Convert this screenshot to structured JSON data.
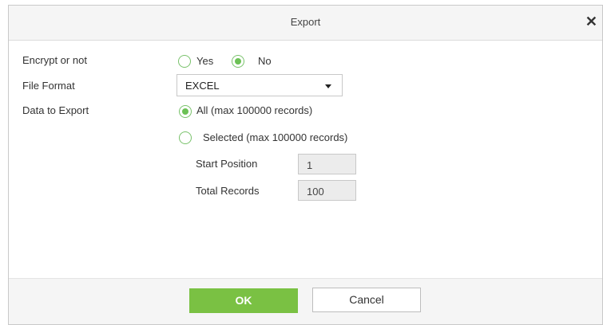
{
  "dialog": {
    "title": "Export",
    "close_icon": "close-icon"
  },
  "form": {
    "encrypt": {
      "label": "Encrypt or not",
      "options": [
        "Yes",
        "No"
      ],
      "selected": "No"
    },
    "file_format": {
      "label": "File Format",
      "value": "EXCEL"
    },
    "data_to_export": {
      "label": "Data to Export",
      "options": [
        "All (max 100000 records)",
        "Selected (max 100000 records)"
      ],
      "selected": "All (max 100000 records)"
    },
    "start_position": {
      "label": "Start Position",
      "value": "1"
    },
    "total_records": {
      "label": "Total Records",
      "value": "100"
    }
  },
  "footer": {
    "ok_label": "OK",
    "cancel_label": "Cancel"
  },
  "colors": {
    "accent": "#7ac143",
    "radio": "#6cc155"
  }
}
